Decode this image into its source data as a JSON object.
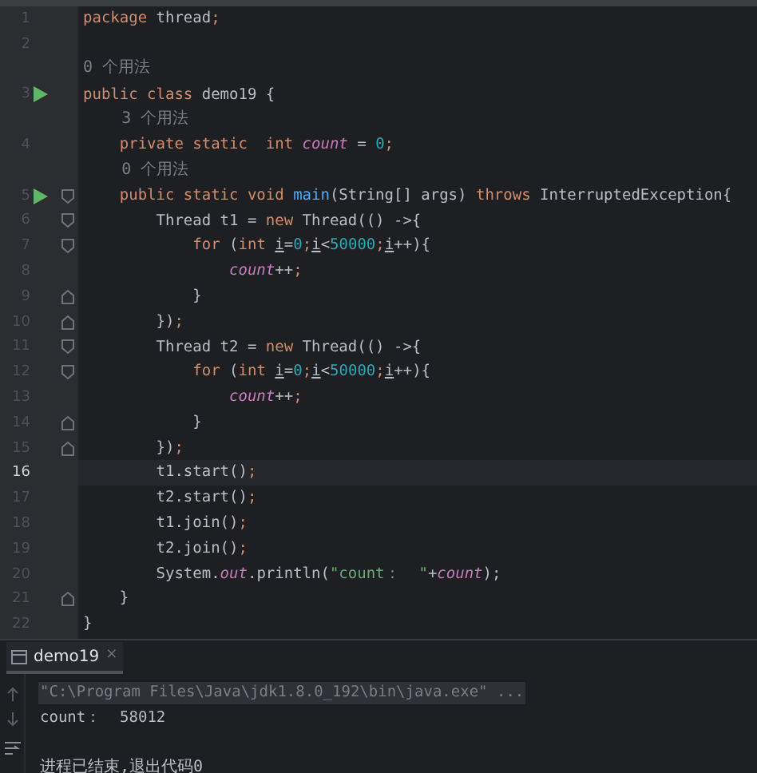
{
  "editor": {
    "lines": [
      {
        "kind": "code",
        "number": "1",
        "current": false,
        "tokens": [
          {
            "kind": "kw",
            "s": "package"
          },
          {
            "kind": "text",
            "s": " thread"
          },
          {
            "kind": "semi",
            "s": ";"
          }
        ]
      },
      {
        "kind": "code",
        "number": "2",
        "current": false
      },
      {
        "kind": "hint",
        "text": "0 个用法"
      },
      {
        "kind": "code",
        "number": "3",
        "run": true,
        "current": false,
        "tokens": [
          {
            "kind": "kw",
            "s": "public class"
          },
          {
            "kind": "text",
            "s": " demo19 {"
          }
        ]
      },
      {
        "kind": "hint",
        "text": "    3 个用法"
      },
      {
        "kind": "code",
        "number": "4",
        "current": false,
        "tokens": [
          {
            "kind": "kw",
            "s": "    private static  int "
          },
          {
            "kind": "field",
            "s": "count"
          },
          {
            "kind": "text",
            "s": " = "
          },
          {
            "kind": "num",
            "s": "0"
          },
          {
            "kind": "semi",
            "s": ";"
          }
        ]
      },
      {
        "kind": "hint",
        "text": "    0 个用法"
      },
      {
        "kind": "code",
        "number": "5",
        "run": true,
        "fold_start": true,
        "current": false,
        "tokens": [
          {
            "kind": "kw",
            "s": "    public static void "
          },
          {
            "kind": "fn",
            "s": "main"
          },
          {
            "kind": "text",
            "s": "(String[] args) "
          },
          {
            "kind": "kw",
            "s": "throws"
          },
          {
            "kind": "text",
            "s": " InterruptedException{"
          }
        ]
      },
      {
        "kind": "code",
        "number": "6",
        "fold_start": true,
        "current": false,
        "tokens": [
          {
            "kind": "text",
            "s": "        Thread t1 = "
          },
          {
            "kind": "kw",
            "s": "new"
          },
          {
            "kind": "text",
            "s": " Thread(() ->{"
          }
        ]
      },
      {
        "kind": "code",
        "number": "7",
        "fold_start": true,
        "current": false,
        "tokens": [
          {
            "kind": "kw",
            "s": "            for"
          },
          {
            "kind": "text",
            "s": " ("
          },
          {
            "kind": "kw",
            "s": "int "
          },
          {
            "kind": "var",
            "s": "i"
          },
          {
            "kind": "text",
            "s": "="
          },
          {
            "kind": "num",
            "s": "0"
          },
          {
            "kind": "semi",
            "s": ";"
          },
          {
            "kind": "var",
            "s": "i"
          },
          {
            "kind": "text",
            "s": "<"
          },
          {
            "kind": "num",
            "s": "50000"
          },
          {
            "kind": "semi",
            "s": ";"
          },
          {
            "kind": "var",
            "s": "i"
          },
          {
            "kind": "text",
            "s": "++){"
          }
        ]
      },
      {
        "kind": "code",
        "number": "8",
        "current": false,
        "tokens": [
          {
            "kind": "field",
            "s": "                count"
          },
          {
            "kind": "text",
            "s": "++"
          },
          {
            "kind": "semi",
            "s": ";"
          }
        ]
      },
      {
        "kind": "code",
        "number": "9",
        "fold_end": true,
        "current": false,
        "tokens": [
          {
            "kind": "text",
            "s": "            }"
          }
        ]
      },
      {
        "kind": "code",
        "number": "10",
        "fold_end": true,
        "current": false,
        "tokens": [
          {
            "kind": "text",
            "s": "        })"
          },
          {
            "kind": "semi",
            "s": ";"
          }
        ]
      },
      {
        "kind": "code",
        "number": "11",
        "fold_start": true,
        "current": false,
        "tokens": [
          {
            "kind": "text",
            "s": "        Thread t2 = "
          },
          {
            "kind": "kw",
            "s": "new"
          },
          {
            "kind": "text",
            "s": " Thread(() ->{"
          }
        ]
      },
      {
        "kind": "code",
        "number": "12",
        "fold_start": true,
        "current": false,
        "tokens": [
          {
            "kind": "kw",
            "s": "            for"
          },
          {
            "kind": "text",
            "s": " ("
          },
          {
            "kind": "kw",
            "s": "int "
          },
          {
            "kind": "var",
            "s": "i"
          },
          {
            "kind": "text",
            "s": "="
          },
          {
            "kind": "num",
            "s": "0"
          },
          {
            "kind": "semi",
            "s": ";"
          },
          {
            "kind": "var",
            "s": "i"
          },
          {
            "kind": "text",
            "s": "<"
          },
          {
            "kind": "num",
            "s": "50000"
          },
          {
            "kind": "semi",
            "s": ";"
          },
          {
            "kind": "var",
            "s": "i"
          },
          {
            "kind": "text",
            "s": "++){"
          }
        ]
      },
      {
        "kind": "code",
        "number": "13",
        "current": false,
        "tokens": [
          {
            "kind": "field",
            "s": "                count"
          },
          {
            "kind": "text",
            "s": "++"
          },
          {
            "kind": "semi",
            "s": ";"
          }
        ]
      },
      {
        "kind": "code",
        "number": "14",
        "fold_end": true,
        "current": false,
        "tokens": [
          {
            "kind": "text",
            "s": "            }"
          }
        ]
      },
      {
        "kind": "code",
        "number": "15",
        "fold_end": true,
        "current": false,
        "tokens": [
          {
            "kind": "text",
            "s": "        })"
          },
          {
            "kind": "semi",
            "s": ";"
          }
        ]
      },
      {
        "kind": "code",
        "number": "16",
        "current": true,
        "tokens": [
          {
            "kind": "text",
            "s": "        t1.start()"
          },
          {
            "kind": "semi",
            "s": ";"
          }
        ]
      },
      {
        "kind": "code",
        "number": "17",
        "current": false,
        "tokens": [
          {
            "kind": "text",
            "s": "        t2.start()"
          },
          {
            "kind": "semi",
            "s": ";"
          }
        ]
      },
      {
        "kind": "code",
        "number": "18",
        "current": false,
        "tokens": [
          {
            "kind": "text",
            "s": "        t1.join()"
          },
          {
            "kind": "semi",
            "s": ";"
          }
        ]
      },
      {
        "kind": "code",
        "number": "19",
        "current": false,
        "tokens": [
          {
            "kind": "text",
            "s": "        t2.join()"
          },
          {
            "kind": "semi",
            "s": ";"
          }
        ]
      },
      {
        "kind": "code",
        "number": "20",
        "current": false,
        "tokens": [
          {
            "kind": "text",
            "s": "        System."
          },
          {
            "kind": "field",
            "s": "out"
          },
          {
            "kind": "text",
            "s": ".println("
          },
          {
            "kind": "str",
            "s": "\"count：  \""
          },
          {
            "kind": "text",
            "s": "+"
          },
          {
            "kind": "field",
            "s": "count"
          },
          {
            "kind": "text",
            "s": ");"
          }
        ]
      },
      {
        "kind": "code",
        "number": "21",
        "fold_end": true,
        "current": false,
        "tokens": [
          {
            "kind": "text",
            "s": "    }"
          }
        ]
      },
      {
        "kind": "code",
        "number": "22",
        "current": false,
        "tokens": [
          {
            "kind": "text",
            "s": "}"
          }
        ]
      }
    ]
  },
  "console": {
    "tab": {
      "label": "demo19",
      "close": "×",
      "selected": true
    },
    "lines": [
      {
        "kind": "command",
        "text": "\"C:\\Program Files\\Java\\jdk1.8.0_192\\bin\\java.exe\" ..."
      },
      {
        "kind": "output",
        "text": "count：  58012"
      },
      {
        "kind": "exit",
        "text": "进程已结束,退出代码0"
      }
    ]
  }
}
